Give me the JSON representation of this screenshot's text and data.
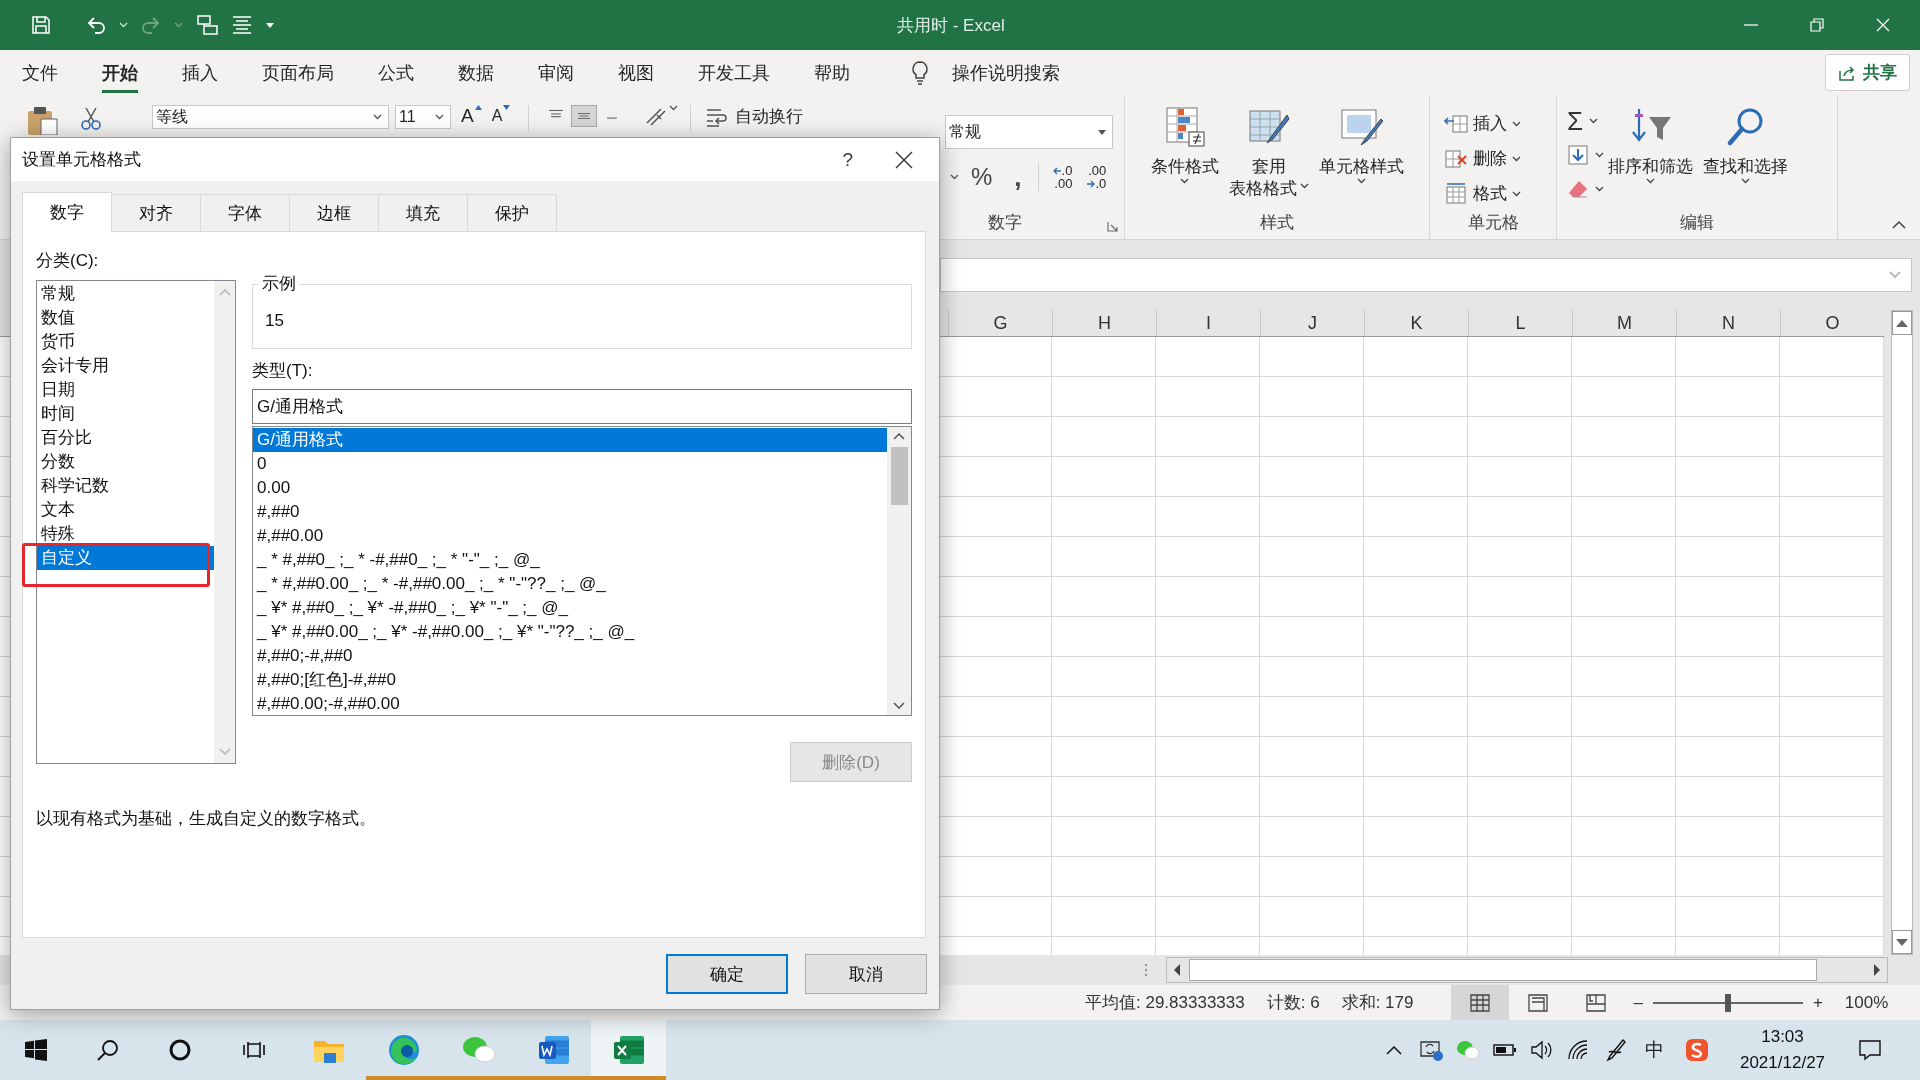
{
  "window": {
    "title": "共用时 - Excel"
  },
  "menu_tabs": [
    {
      "label": "文件",
      "selected": false
    },
    {
      "label": "开始",
      "selected": true
    },
    {
      "label": "插入",
      "selected": false
    },
    {
      "label": "页面布局",
      "selected": false
    },
    {
      "label": "公式",
      "selected": false
    },
    {
      "label": "数据",
      "selected": false
    },
    {
      "label": "审阅",
      "selected": false
    },
    {
      "label": "视图",
      "selected": false
    },
    {
      "label": "开发工具",
      "selected": false
    },
    {
      "label": "帮助",
      "selected": false
    }
  ],
  "tell_me": {
    "label": "操作说明搜索"
  },
  "share_button": {
    "label": "共享"
  },
  "ribbon": {
    "font_name": "等线",
    "font_size": "11",
    "font_grow": "A",
    "font_shrink": "A",
    "wrap_text": "自动换行",
    "number_format": "常规",
    "percent": "%",
    "comma": ",",
    "decimal_buttons": [
      {
        "kind": "increase",
        "lines": [
          ".0",
          ".00"
        ]
      },
      {
        "kind": "decrease",
        "lines": [
          ".00",
          ".0"
        ]
      }
    ],
    "number_group": "数字",
    "style_buttons": [
      {
        "kind": "conditional",
        "lines": [
          "条件格式"
        ]
      },
      {
        "kind": "table",
        "lines": [
          "套用",
          "表格格式"
        ]
      },
      {
        "kind": "cell_style",
        "lines": [
          "单元格样式"
        ]
      }
    ],
    "styles_group": "样式",
    "cell_buttons": [
      {
        "kind": "insert",
        "label": "插入"
      },
      {
        "kind": "delete",
        "label": "删除"
      },
      {
        "kind": "format",
        "label": "格式"
      }
    ],
    "cells_group": "单元格",
    "autosum": "Σ",
    "edit_buttons": [
      {
        "kind": "sort",
        "label": "排序和筛选"
      },
      {
        "kind": "find",
        "label": "查找和选择"
      }
    ],
    "editing_group": "编辑"
  },
  "sheet": {
    "columns": [
      "G",
      "H",
      "I",
      "J",
      "K",
      "L",
      "M",
      "N",
      "O"
    ]
  },
  "status_bar": {
    "average": "平均值: 29.83333333",
    "count": "计数: 6",
    "sum": "求和: 179",
    "views": [
      {
        "kind": "normal",
        "selected": true
      },
      {
        "kind": "page_layout",
        "selected": false
      },
      {
        "kind": "page_break",
        "selected": false
      }
    ],
    "zoom_minus": "–",
    "zoom_slider": {
      "level": 0.5
    },
    "zoom_plus": "+",
    "zoom": "100%"
  },
  "taskbar": {
    "apps": [
      {
        "kind": "explorer",
        "running": false,
        "active": false
      },
      {
        "kind": "edge",
        "running": true,
        "active": false
      },
      {
        "kind": "wechat",
        "running": true,
        "active": false
      },
      {
        "kind": "word",
        "running": true,
        "active": false
      },
      {
        "kind": "excel",
        "running": true,
        "active": true
      }
    ],
    "ime": "中",
    "time": "13:03",
    "date": "2021/12/27"
  },
  "dialog": {
    "title": "设置单元格格式",
    "help": "?",
    "tabs": [
      {
        "label": "数字",
        "selected": true
      },
      {
        "label": "对齐",
        "selected": false
      },
      {
        "label": "字体",
        "selected": false
      },
      {
        "label": "边框",
        "selected": false
      },
      {
        "label": "填充",
        "selected": false
      },
      {
        "label": "保护",
        "selected": false
      }
    ],
    "category_label": "分类(C):",
    "categories": [
      {
        "label": "常规",
        "selected": false,
        "highlighted": false
      },
      {
        "label": "数值",
        "selected": false,
        "highlighted": false
      },
      {
        "label": "货币",
        "selected": false,
        "highlighted": false
      },
      {
        "label": "会计专用",
        "selected": false,
        "highlighted": false
      },
      {
        "label": "日期",
        "selected": false,
        "highlighted": false
      },
      {
        "label": "时间",
        "selected": false,
        "highlighted": false
      },
      {
        "label": "百分比",
        "selected": false,
        "highlighted": false
      },
      {
        "label": "分数",
        "selected": false,
        "highlighted": false
      },
      {
        "label": "科学记数",
        "selected": false,
        "highlighted": false
      },
      {
        "label": "文本",
        "selected": false,
        "highlighted": false
      },
      {
        "label": "特殊",
        "selected": false,
        "highlighted": false
      },
      {
        "label": "自定义",
        "selected": true,
        "highlighted": true
      }
    ],
    "sample": {
      "legend": "示例",
      "value": "15"
    },
    "type_label": "类型(T):",
    "type_value": "G/通用格式",
    "types": [
      {
        "label": "G/通用格式",
        "selected": true
      },
      {
        "label": "0",
        "selected": false
      },
      {
        "label": "0.00",
        "selected": false
      },
      {
        "label": "#,##0",
        "selected": false
      },
      {
        "label": "#,##0.00",
        "selected": false
      },
      {
        "label": "_ * #,##0_ ;_ * -#,##0_ ;_ * \"-\"_ ;_ @_",
        "selected": false
      },
      {
        "label": "_ * #,##0.00_ ;_ * -#,##0.00_ ;_ * \"-\"??_ ;_ @_",
        "selected": false
      },
      {
        "label": "_ ¥* #,##0_ ;_ ¥* -#,##0_ ;_ ¥* \"-\"_ ;_ @_",
        "selected": false
      },
      {
        "label": "_ ¥* #,##0.00_ ;_ ¥* -#,##0.00_ ;_ ¥* \"-\"??_ ;_ @_",
        "selected": false
      },
      {
        "label": "#,##0;-#,##0",
        "selected": false
      },
      {
        "label": "#,##0;[红色]-#,##0",
        "selected": false
      },
      {
        "label": "#,##0.00;-#,##0.00",
        "selected": false
      }
    ],
    "delete_button": {
      "label": "删除(D)",
      "disabled": true
    },
    "description": "以现有格式为基础，生成自定义的数字格式。",
    "ok_button": "确定",
    "cancel_button": "取消"
  }
}
